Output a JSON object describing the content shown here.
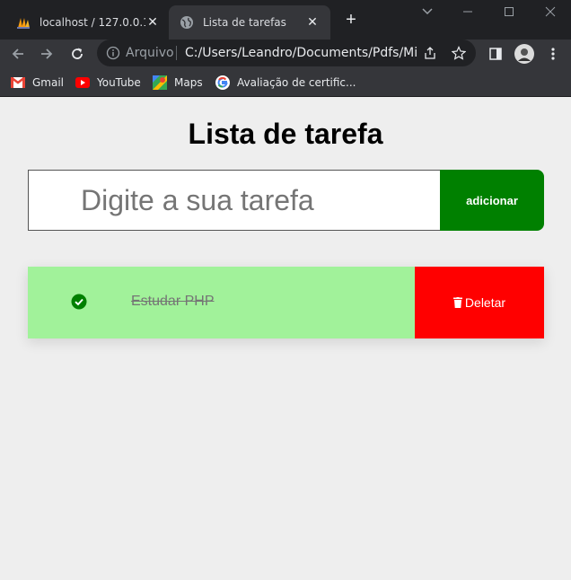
{
  "browser": {
    "tabs": [
      {
        "title": "localhost / 127.0.0.1 /",
        "active": false,
        "icon": "phpmyadmin-icon"
      },
      {
        "title": "Lista de tarefas",
        "active": true,
        "icon": "globe-icon"
      }
    ],
    "address": {
      "scheme_label": "Arquivo",
      "url": "C:/Users/Leandro/Documents/Pdfs/Min..."
    },
    "bookmarks": [
      {
        "label": "Gmail",
        "icon": "gmail-icon"
      },
      {
        "label": "YouTube",
        "icon": "youtube-icon"
      },
      {
        "label": "Maps",
        "icon": "maps-icon"
      },
      {
        "label": "Avaliação de certific...",
        "icon": "google-icon"
      }
    ]
  },
  "app": {
    "title": "Lista de tarefa",
    "input": {
      "placeholder": "Digite a sua tarefa",
      "value": ""
    },
    "add_label": "adicionar",
    "tasks": [
      {
        "text": "Estudar PHP",
        "done": true,
        "delete_label": "Deletar"
      }
    ],
    "colors": {
      "add_button": "#008000",
      "task_done_bg": "#a1f29a",
      "delete_button": "#ff0000",
      "check": "#008000"
    }
  }
}
